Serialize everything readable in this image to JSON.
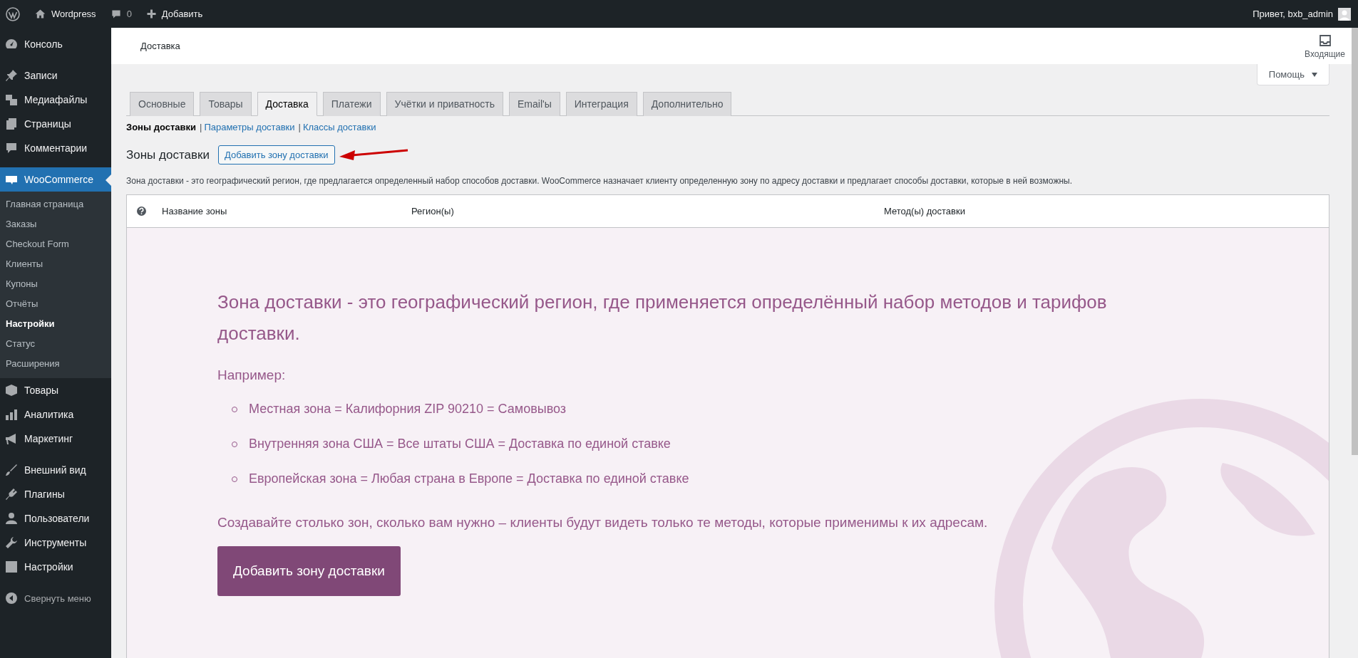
{
  "admin_bar": {
    "site_name": "Wordpress",
    "comments_count": "0",
    "new_label": "Добавить",
    "greeting": "Привет, bxb_admin"
  },
  "sidebar": {
    "groups": [
      [
        {
          "label": "Консоль",
          "selected": false
        }
      ],
      [
        {
          "label": "Записи",
          "selected": false
        },
        {
          "label": "Медиафайлы",
          "selected": false
        },
        {
          "label": "Страницы",
          "selected": false
        },
        {
          "label": "Комментарии",
          "selected": false
        }
      ],
      [
        {
          "label": "WooCommerce",
          "selected": true,
          "children": [
            {
              "label": "Главная страница",
              "selected": false
            },
            {
              "label": "Заказы",
              "selected": false
            },
            {
              "label": "Checkout Form",
              "selected": false
            },
            {
              "label": "Клиенты",
              "selected": false
            },
            {
              "label": "Купоны",
              "selected": false
            },
            {
              "label": "Отчёты",
              "selected": false
            },
            {
              "label": "Настройки",
              "selected": true
            },
            {
              "label": "Статус",
              "selected": false
            },
            {
              "label": "Расширения",
              "selected": false
            }
          ]
        },
        {
          "label": "Товары",
          "selected": false
        },
        {
          "label": "Аналитика",
          "selected": false
        },
        {
          "label": "Маркетинг",
          "selected": false
        }
      ],
      [
        {
          "label": "Внешний вид",
          "selected": false
        },
        {
          "label": "Плагины",
          "selected": false
        },
        {
          "label": "Пользователи",
          "selected": false
        },
        {
          "label": "Инструменты",
          "selected": false
        },
        {
          "label": "Настройки",
          "selected": false
        }
      ]
    ],
    "collapse_label": "Свернуть меню"
  },
  "header": {
    "title": "Доставка",
    "inbox_label": "Входящие"
  },
  "help_button": "Помощь",
  "tabs": [
    {
      "label": "Основные",
      "selected": false
    },
    {
      "label": "Товары",
      "selected": false
    },
    {
      "label": "Доставка",
      "selected": true
    },
    {
      "label": "Платежи",
      "selected": false
    },
    {
      "label": "Учётки и приватность",
      "selected": false
    },
    {
      "label": "Email'ы",
      "selected": false
    },
    {
      "label": "Интеграция",
      "selected": false
    },
    {
      "label": "Дополнительно",
      "selected": false
    }
  ],
  "subnav": {
    "separator": "|",
    "links": [
      {
        "label": "Зоны доставки",
        "selected": true
      },
      {
        "label": "Параметры доставки",
        "selected": false
      },
      {
        "label": "Классы доставки",
        "selected": false
      }
    ]
  },
  "section": {
    "title": "Зоны доставки",
    "add_button": "Добавить зону доставки",
    "description": "Зона доставки - это географический регион, где предлагается определенный набор способов доставки. WooCommerce назначает клиенту определенную зону по адресу доставки и предлагает способы доставки, которые в ней возможны."
  },
  "table": {
    "columns": [
      "Название зоны",
      "Регион(ы)",
      "Метод(ы) доставки"
    ]
  },
  "empty_state": {
    "title": "Зона доставки - это географический регион, где применяется определённый набор методов и тарифов доставки.",
    "example_label": "Например:",
    "examples": [
      "Местная зона = Калифорния ZIP 90210 = Самовывоз",
      "Внутренняя зона США = Все штаты США = Доставка по единой ставке",
      "Европейская зона = Любая страна в Европе = Доставка по единой ставке"
    ],
    "footer": "Создавайте столько зон, сколько вам нужно – клиенты будут видеть только те методы, которые применимы к их адресам.",
    "button": "Добавить зону доставки"
  }
}
